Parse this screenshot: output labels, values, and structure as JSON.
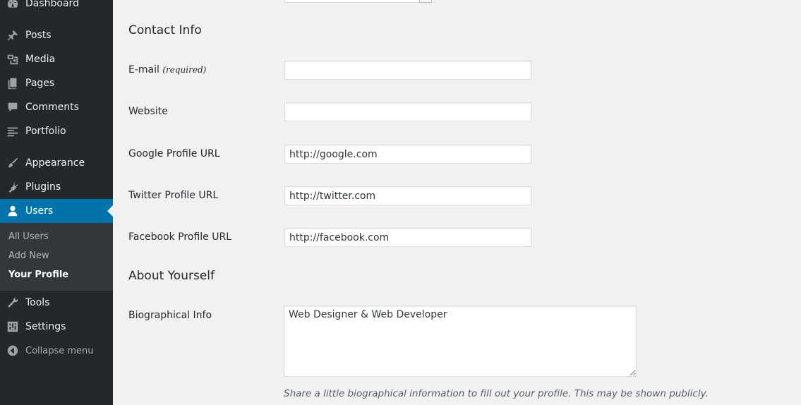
{
  "sidebar": {
    "items": [
      {
        "label": "Dashboard",
        "icon": "dashboard-icon"
      },
      {
        "label": "Posts",
        "icon": "pin-icon"
      },
      {
        "label": "Media",
        "icon": "media-icon"
      },
      {
        "label": "Pages",
        "icon": "pages-icon"
      },
      {
        "label": "Comments",
        "icon": "comment-icon"
      },
      {
        "label": "Portfolio",
        "icon": "list-icon"
      },
      {
        "label": "Appearance",
        "icon": "brush-icon"
      },
      {
        "label": "Plugins",
        "icon": "plug-icon"
      },
      {
        "label": "Users",
        "icon": "user-icon"
      },
      {
        "label": "Tools",
        "icon": "wrench-icon"
      },
      {
        "label": "Settings",
        "icon": "sliders-icon"
      }
    ],
    "submenu": [
      "All Users",
      "Add New",
      "Your Profile"
    ],
    "collapse_label": "Collapse menu",
    "active_color": "#0073aa",
    "background_color": "#23282d"
  },
  "main": {
    "contact_section_title": "Contact Info",
    "fields": [
      {
        "label": "E-mail",
        "note": "(required)",
        "value": ""
      },
      {
        "label": "Website",
        "value": ""
      },
      {
        "label": "Google Profile URL",
        "value": "http://google.com"
      },
      {
        "label": "Twitter Profile URL",
        "value": "http://twitter.com"
      },
      {
        "label": "Facebook Profile URL",
        "value": "http://facebook.com"
      }
    ],
    "about_section_title": "About Yourself",
    "bio": {
      "label": "Biographical Info",
      "value": "Web Designer & Web Developer",
      "description": "Share a little biographical information to fill out your profile. This may be shown publicly."
    }
  }
}
